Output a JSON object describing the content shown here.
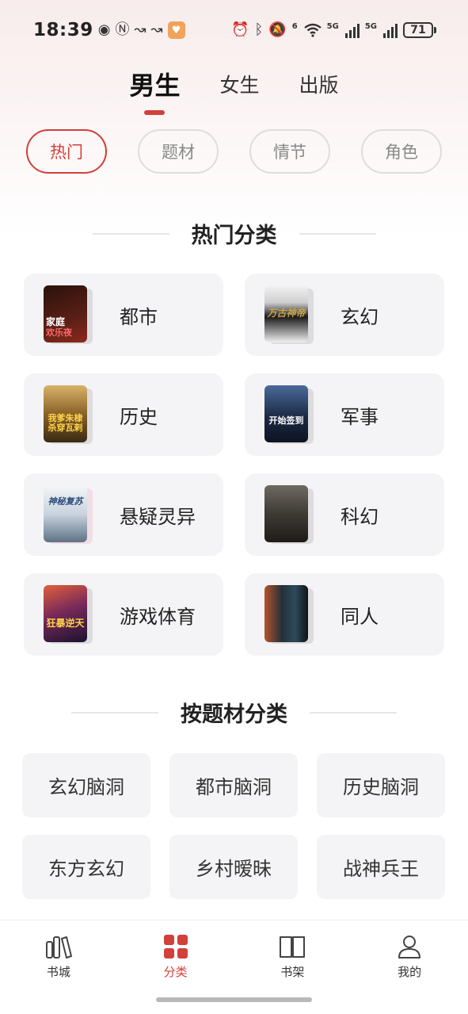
{
  "status_bar": {
    "time": "18:39",
    "battery": "71",
    "network_1": "5G",
    "network_2": "5G",
    "wifi_badge": "6"
  },
  "gender_tabs": [
    {
      "label": "男生",
      "active": true
    },
    {
      "label": "女生",
      "active": false
    },
    {
      "label": "出版",
      "active": false
    }
  ],
  "filter_chips": [
    {
      "label": "热门",
      "active": true
    },
    {
      "label": "题材",
      "active": false
    },
    {
      "label": "情节",
      "active": false
    },
    {
      "label": "角色",
      "active": false
    }
  ],
  "hot_section": {
    "title": "热门分类",
    "items": [
      {
        "label": "都市",
        "cover_text": "家庭\n欢乐夜",
        "cover_color": "#5a1f16"
      },
      {
        "label": "玄幻",
        "cover_text": "万古神帝",
        "cover_color": "#2b2b2b"
      },
      {
        "label": "历史",
        "cover_text": "我爹朱棣\n杀穿瓦剌",
        "cover_color": "#7a5a1e"
      },
      {
        "label": "军事",
        "cover_text": "开始签到",
        "cover_color": "#1c2a44"
      },
      {
        "label": "悬疑灵异",
        "cover_text": "神秘复苏",
        "cover_color": "#8aa0b8"
      },
      {
        "label": "科幻",
        "cover_text": "",
        "cover_color": "#3e3a34"
      },
      {
        "label": "游戏体育",
        "cover_text": "狂暴逆天",
        "cover_color": "#4a1a3a"
      },
      {
        "label": "同人",
        "cover_text": "",
        "cover_color": "#24303a"
      }
    ]
  },
  "topic_section": {
    "title": "按题材分类",
    "items": [
      "玄幻脑洞",
      "都市脑洞",
      "历史脑洞",
      "东方玄幻",
      "乡村暧昧",
      "战神兵王"
    ]
  },
  "bottom_nav": [
    {
      "label": "书城",
      "icon": "bookstore-icon",
      "active": false
    },
    {
      "label": "分类",
      "icon": "category-grid-icon",
      "active": true
    },
    {
      "label": "书架",
      "icon": "bookshelf-icon",
      "active": false
    },
    {
      "label": "我的",
      "icon": "profile-icon",
      "active": false
    }
  ],
  "colors": {
    "accent": "#d2403a",
    "card_bg": "#f4f4f6"
  }
}
